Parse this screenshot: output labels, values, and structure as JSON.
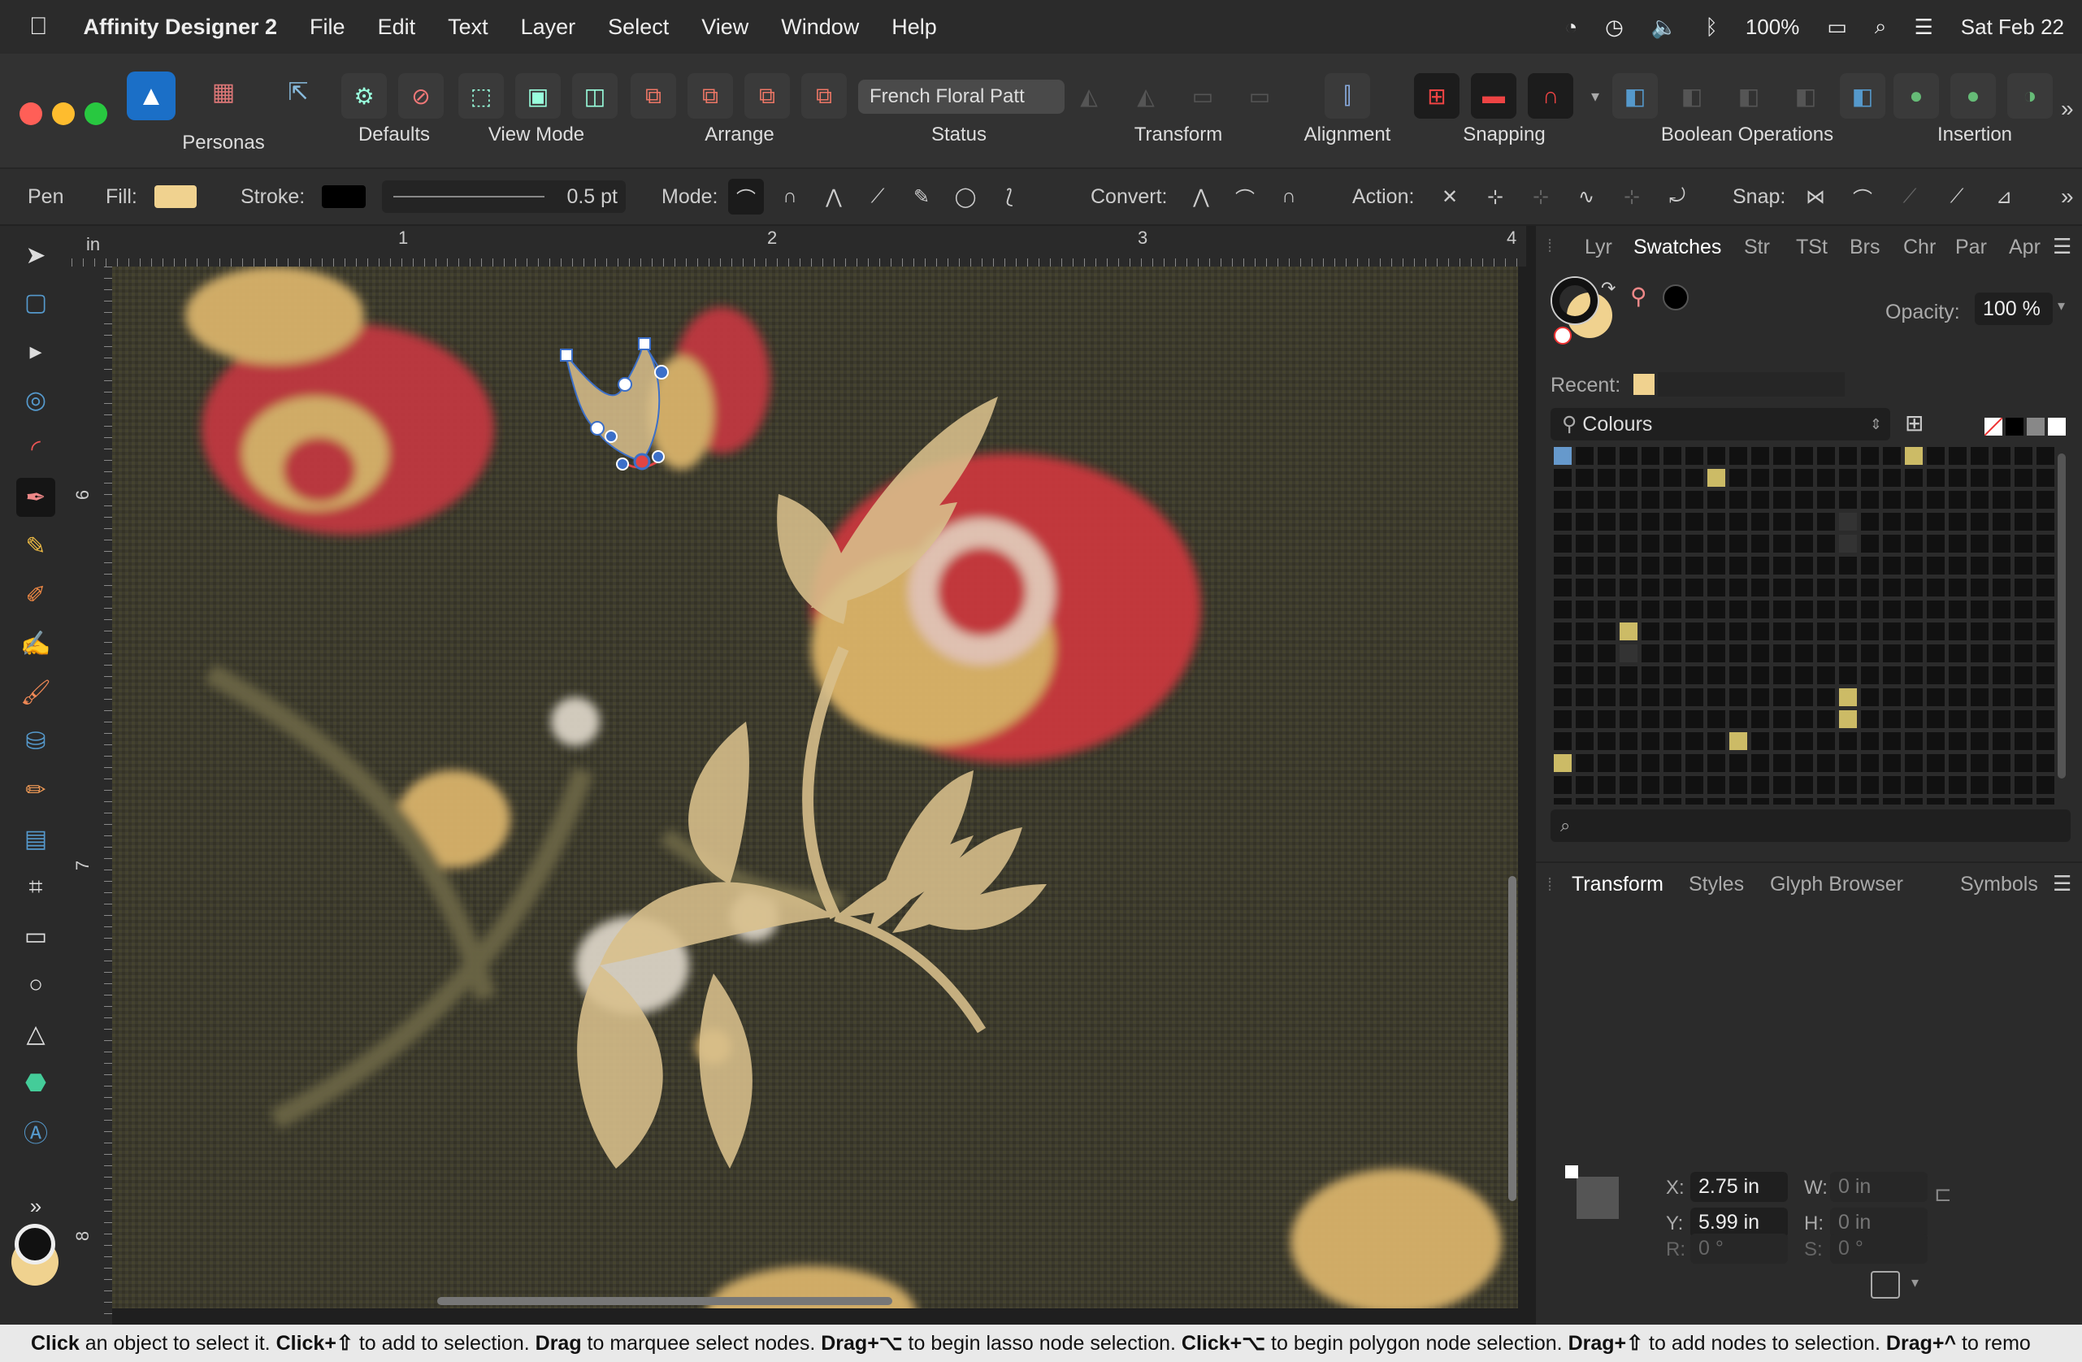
{
  "menubar": {
    "app_name": "Affinity Designer 2",
    "items": [
      "File",
      "Edit",
      "Text",
      "Layer",
      "Select",
      "View",
      "Window",
      "Help"
    ],
    "battery": "100%",
    "date": "Sat Feb 22"
  },
  "toolbar": {
    "personas_label": "Personas",
    "defaults_label": "Defaults",
    "viewmode_label": "View Mode",
    "arrange_label": "Arrange",
    "status_label": "Status",
    "status_value": "French Floral Patt⁠",
    "transform_label": "Transform",
    "alignment_label": "Alignment",
    "snapping_label": "Snapping",
    "boolean_label": "Boolean Operations",
    "insertion_label": "Insertion"
  },
  "context": {
    "tool": "Pen",
    "fill_label": "Fill:",
    "stroke_label": "Stroke:",
    "stroke_width": "0.5 pt",
    "mode_label": "Mode:",
    "convert_label": "Convert:",
    "action_label": "Action:",
    "snap_label": "Snap:",
    "fill_color": "#f0d28f",
    "stroke_color": "#000000"
  },
  "rulers": {
    "unit": "in",
    "h_ticks": [
      "1",
      "2",
      "3",
      "4"
    ],
    "v_ticks": [
      "6",
      "7",
      "8"
    ]
  },
  "panel": {
    "tabs": [
      "Lyr",
      "Swatches",
      "Str",
      "TSt",
      "Brs",
      "Chr",
      "Par",
      "Apr"
    ],
    "active_tab": "Swatches",
    "opacity_label": "Opacity:",
    "opacity_value": "100 %",
    "recent_label": "Recent:",
    "palette_name": "Colours",
    "bottom_tabs": [
      "Transform",
      "Styles",
      "Glyph Browser",
      "Symbols"
    ],
    "transform": {
      "x_label": "X:",
      "x_value": "2.75 in",
      "y_label": "Y:",
      "y_value": "5.99 in",
      "w_label": "W:",
      "w_value": "0 in",
      "h_label": "H:",
      "h_value": "0 in",
      "r_label": "R:",
      "r_value": "0 °",
      "s_label": "S:",
      "s_value": "0 °"
    }
  },
  "statusbar": {
    "parts": [
      {
        "b": "Click"
      },
      {
        "t": " an object to select it. "
      },
      {
        "b": "Click+⇧"
      },
      {
        "t": " to add to selection. "
      },
      {
        "b": "Drag"
      },
      {
        "t": " to marquee select nodes. "
      },
      {
        "b": "Drag+⌥"
      },
      {
        "t": " to begin lasso node selection. "
      },
      {
        "b": "Click+⌥"
      },
      {
        "t": " to begin polygon node selection. "
      },
      {
        "b": "Drag+⇧"
      },
      {
        "t": " to add nodes to selection. "
      },
      {
        "b": "Drag+^"
      },
      {
        "t": " to remo"
      }
    ]
  }
}
